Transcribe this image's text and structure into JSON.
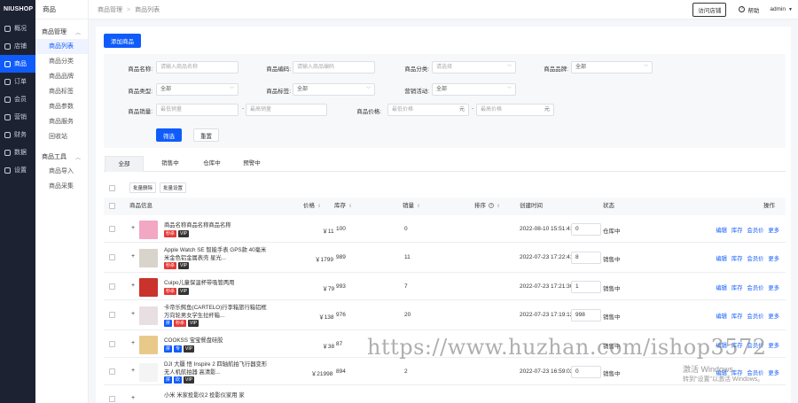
{
  "logo": "NIUSHOP",
  "main_nav": [
    {
      "label": "概况",
      "icon": "overview-icon",
      "active": false
    },
    {
      "label": "店铺",
      "icon": "store-icon",
      "active": false
    },
    {
      "label": "商品",
      "icon": "goods-icon",
      "active": true
    },
    {
      "label": "订单",
      "icon": "order-icon",
      "active": false
    },
    {
      "label": "会员",
      "icon": "member-icon",
      "active": false
    },
    {
      "label": "营销",
      "icon": "marketing-icon",
      "active": false
    },
    {
      "label": "财务",
      "icon": "finance-icon",
      "active": false
    },
    {
      "label": "数据",
      "icon": "data-icon",
      "active": false
    },
    {
      "label": "设置",
      "icon": "settings-icon",
      "active": false
    }
  ],
  "sub_nav": {
    "title": "商品",
    "group1": "商品管理",
    "group1_items": [
      "商品列表",
      "商品分类",
      "商品品牌",
      "商品标签",
      "商品参数",
      "商品服务",
      "回收站"
    ],
    "group2": "商品工具",
    "group2_items": [
      "商品导入",
      "商品采集"
    ]
  },
  "breadcrumb": [
    "商品管理",
    "商品列表"
  ],
  "topbar": {
    "visit_store": "访问店铺",
    "help": "帮助",
    "user": "admin"
  },
  "add_button": "添加商品",
  "filters": {
    "goods_name": {
      "label": "商品名称:",
      "placeholder": "请输入商品名称"
    },
    "goods_code": {
      "label": "商品编码:",
      "placeholder": "请输入商品编码"
    },
    "category": {
      "label": "商品分类:",
      "placeholder": "请选择"
    },
    "brand": {
      "label": "商品品牌:",
      "value": "全部"
    },
    "goods_type": {
      "label": "商品类型:",
      "value": "全部"
    },
    "goods_tag": {
      "label": "商品标签:",
      "value": "全部"
    },
    "promotion": {
      "label": "营销活动:",
      "value": "全部"
    },
    "sales": {
      "label": "商品销量:",
      "min_placeholder": "最低销量",
      "max_placeholder": "最高销量"
    },
    "price": {
      "label": "商品价格:",
      "min_placeholder": "最低价格",
      "max_placeholder": "最高价格",
      "unit": "元"
    },
    "search_btn": "筛选",
    "reset_btn": "重置"
  },
  "tabs": [
    "全部",
    "销售中",
    "仓库中",
    "预警中"
  ],
  "bulk": {
    "delete": "批量删除",
    "settings": "批量设置"
  },
  "columns": {
    "info": "商品信息",
    "price": "价格",
    "stock": "库存",
    "sales": "销量",
    "sort": "排序",
    "created": "创建时间",
    "status": "状态",
    "actions": "操作"
  },
  "row_actions": [
    "编辑",
    "库存",
    "会员价",
    "更多"
  ],
  "rows": [
    {
      "name": "商品名称商品名称商品名称",
      "tags": [
        {
          "t": "秒杀",
          "c": "red"
        },
        {
          "t": "VIP",
          "c": "dark"
        }
      ],
      "price": "￥11",
      "stock": "100",
      "sales": "0",
      "sort": "0",
      "created": "2022-08-10 15:51:41",
      "status": "仓库中",
      "thumb": "#f2a7c3"
    },
    {
      "name": "Apple Watch SE 智能手表 GPS款 40毫米米金色铝金属表壳 星光...",
      "tags": [
        {
          "t": "秒杀",
          "c": "red"
        },
        {
          "t": "VIP",
          "c": "dark"
        }
      ],
      "price": "￥1799",
      "stock": "989",
      "sales": "11",
      "sort": "8",
      "created": "2022-07-23 17:22:41",
      "status": "销售中",
      "thumb": "#d8d4cc"
    },
    {
      "name": "Cuipo儿童保温杯带吸管两用",
      "tags": [
        {
          "t": "秒杀",
          "c": "red"
        },
        {
          "t": "VIP",
          "c": "dark"
        }
      ],
      "price": "￥79",
      "stock": "993",
      "sales": "7",
      "sort": "1",
      "created": "2022-07-23 17:21:30",
      "status": "销售中",
      "thumb": "#c9332b"
    },
    {
      "name": "卡帝乐鳄鱼(CARTELO)行李箱旅行箱铝框万向轮男女学生拉杆箱...",
      "tags": [
        {
          "t": "拼",
          "c": "blue"
        },
        {
          "t": "秒杀",
          "c": "red"
        },
        {
          "t": "VIP",
          "c": "dark"
        }
      ],
      "price": "￥138",
      "stock": "976",
      "sales": "20",
      "sort": "998",
      "created": "2022-07-23 17:19:12",
      "status": "销售中",
      "thumb": "#e8dfe3"
    },
    {
      "name": "COOKSS 宝宝餐盘硅胶",
      "tags": [
        {
          "t": "拼",
          "c": "blue"
        },
        {
          "t": "专",
          "c": "blue"
        },
        {
          "t": "VIP",
          "c": "dark"
        }
      ],
      "price": "￥38",
      "stock": "87",
      "sales": "",
      "sort": "",
      "created": "",
      "status": "销售中",
      "thumb": "#e9c98a"
    },
    {
      "name": "DJI 大疆 悟 Inspire 2 四轴航拍飞行器变形无人机航拍器 高清影...",
      "tags": [
        {
          "t": "拼",
          "c": "blue"
        },
        {
          "t": "砍",
          "c": "blue"
        },
        {
          "t": "VIP",
          "c": "dark"
        }
      ],
      "price": "￥21998",
      "stock": "894",
      "sales": "2",
      "sort": "0",
      "created": "2022-07-23 16:59:03",
      "status": "销售中",
      "thumb": "#f4f4f4"
    },
    {
      "name": "小米 米家投影仪2 投影仪家用 家",
      "tags": [],
      "price": "",
      "stock": "",
      "sales": "",
      "sort": "",
      "created": "",
      "status": "",
      "thumb": "#ffffff"
    }
  ],
  "watermark": "https://www.huzhan.com/ishop3572",
  "windows_activation": {
    "line1": "激活 Windows",
    "line2": "转到\"设置\"以激活 Windows。"
  }
}
